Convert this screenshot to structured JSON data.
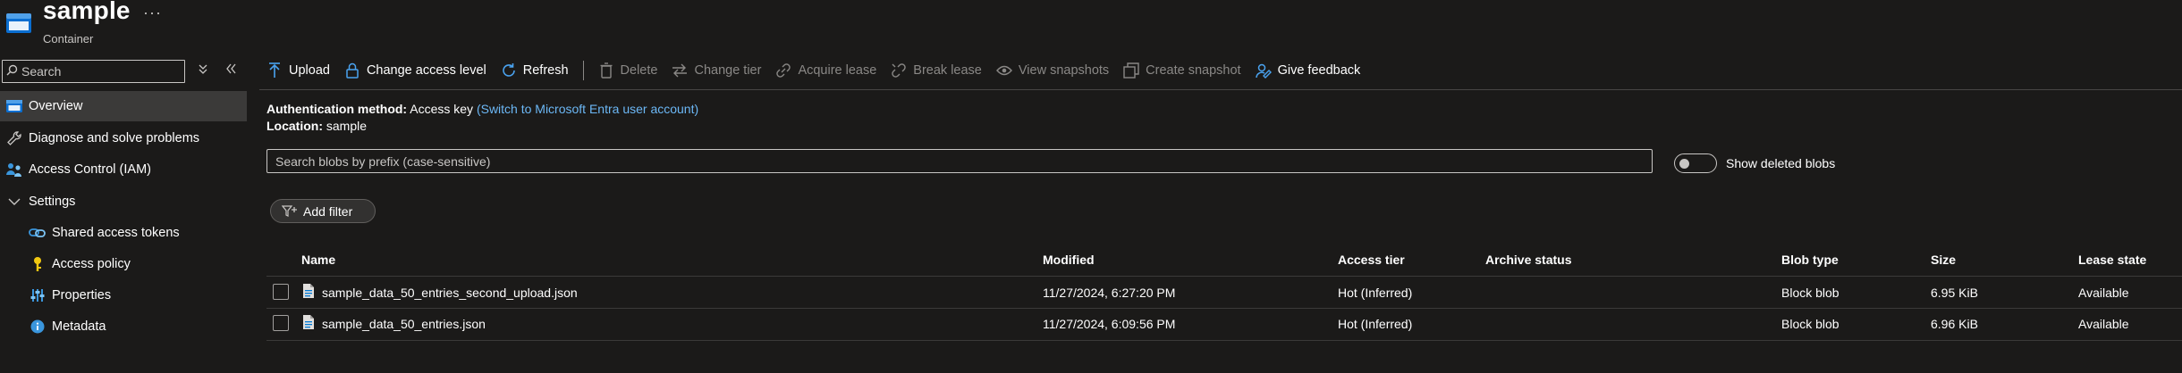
{
  "header": {
    "title": "sample",
    "more": "···",
    "subtitle": "Container"
  },
  "sidebar": {
    "search_placeholder": "Search",
    "items": [
      {
        "label": "Overview",
        "icon": "overview-icon",
        "active": true
      },
      {
        "label": "Diagnose and solve problems",
        "icon": "wrench-icon"
      },
      {
        "label": "Access Control (IAM)",
        "icon": "people-icon"
      },
      {
        "label": "Settings",
        "icon": "chevron-down-icon"
      },
      {
        "label": "Shared access tokens",
        "icon": "link-icon"
      },
      {
        "label": "Access policy",
        "icon": "key-icon"
      },
      {
        "label": "Properties",
        "icon": "sliders-icon"
      },
      {
        "label": "Metadata",
        "icon": "info-icon"
      }
    ]
  },
  "toolbar": {
    "upload": "Upload",
    "change_access": "Change access level",
    "refresh": "Refresh",
    "delete": "Delete",
    "change_tier": "Change tier",
    "acquire_lease": "Acquire lease",
    "break_lease": "Break lease",
    "view_snapshots": "View snapshots",
    "create_snapshot": "Create snapshot",
    "give_feedback": "Give feedback"
  },
  "info": {
    "auth_label": "Authentication method:",
    "auth_value": "Access key",
    "auth_link": "(Switch to Microsoft Entra user account)",
    "location_label": "Location:",
    "location_value": "sample"
  },
  "filters": {
    "search_placeholder": "Search blobs by prefix (case-sensitive)",
    "show_deleted": "Show deleted blobs",
    "add_filter": "Add filter"
  },
  "table": {
    "columns": {
      "name": "Name",
      "modified": "Modified",
      "access_tier": "Access tier",
      "archive_status": "Archive status",
      "blob_type": "Blob type",
      "size": "Size",
      "lease_state": "Lease state"
    },
    "rows": [
      {
        "name": "sample_data_50_entries_second_upload.json",
        "modified": "11/27/2024, 6:27:20 PM",
        "access_tier": "Hot (Inferred)",
        "archive_status": "",
        "blob_type": "Block blob",
        "size": "6.95 KiB",
        "lease_state": "Available"
      },
      {
        "name": "sample_data_50_entries.json",
        "modified": "11/27/2024, 6:09:56 PM",
        "access_tier": "Hot (Inferred)",
        "archive_status": "",
        "blob_type": "Block blob",
        "size": "6.96 KiB",
        "lease_state": "Available"
      }
    ]
  },
  "colors": {
    "background": "#1b1a19",
    "accent": "#0078d4",
    "link": "#6cb8f6",
    "active_nav": "#3b3a39"
  }
}
